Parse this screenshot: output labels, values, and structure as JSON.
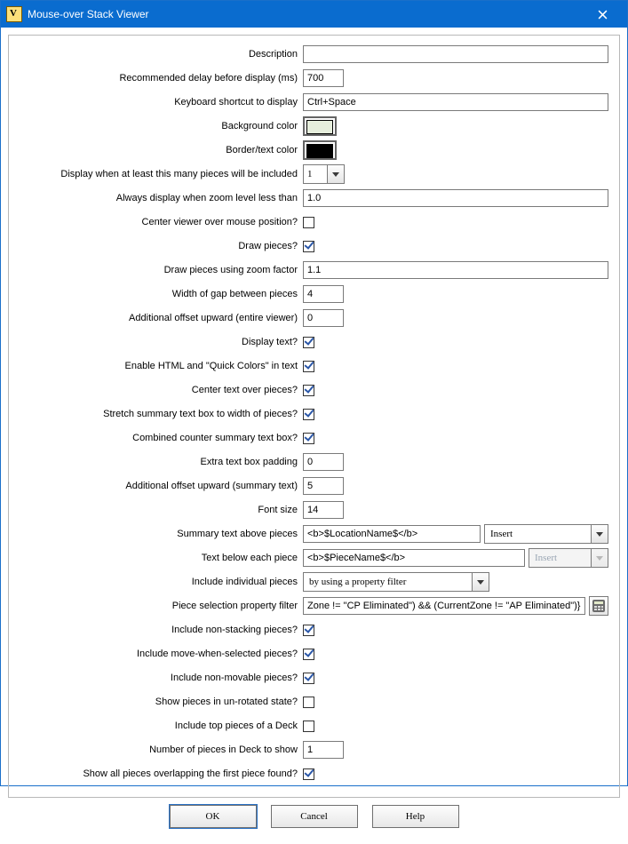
{
  "window": {
    "title": "Mouse-over Stack Viewer"
  },
  "colors": {
    "background_color_swatch": "#e6eedc",
    "border_text_color_swatch": "#000000"
  },
  "labels": {
    "description": "Description",
    "rec_delay": "Recommended delay before display (ms)",
    "kb_shortcut": "Keyboard shortcut to display",
    "bg_color": "Background color",
    "border_text_color": "Border/text color",
    "display_when_pieces": "Display when at least this many pieces will be included",
    "always_display_zoom": "Always display when zoom level less than",
    "center_viewer": "Center viewer over mouse position?",
    "draw_pieces": "Draw pieces?",
    "draw_zoom_factor": "Draw pieces using zoom factor",
    "gap_width": "Width of gap between pieces",
    "offset_upward_viewer": "Additional offset upward (entire viewer)",
    "display_text": "Display text?",
    "enable_html_colors": "Enable HTML and \"Quick Colors\" in text",
    "center_text": "Center text over pieces?",
    "stretch_textbox": "Stretch summary text box to width of pieces?",
    "combined_counter": "Combined counter summary text box?",
    "extra_padding": "Extra text box padding",
    "offset_upward_summary": "Additional offset upward (summary text)",
    "font_size": "Font size",
    "summary_above": "Summary text above pieces",
    "text_below": "Text below each piece",
    "include_individual": "Include individual pieces",
    "piece_filter": "Piece selection property filter",
    "include_nonstacking": "Include non-stacking pieces?",
    "include_movewhen": "Include move-when-selected pieces?",
    "include_nonmovable": "Include non-movable pieces?",
    "show_unrotated": "Show pieces in un-rotated state?",
    "include_top_deck": "Include top pieces of a Deck",
    "num_deck": "Number of pieces in Deck to show",
    "show_all_overlap": "Show all pieces overlapping the first piece found?"
  },
  "values": {
    "description": "",
    "rec_delay": "700",
    "kb_shortcut": "Ctrl+Space",
    "display_when_pieces": "1",
    "always_display_zoom": "1.0",
    "center_viewer": false,
    "draw_pieces": true,
    "draw_zoom_factor": "1.1",
    "gap_width": "4",
    "offset_upward_viewer": "0",
    "display_text": true,
    "enable_html_colors": true,
    "center_text": true,
    "stretch_textbox": true,
    "combined_counter": true,
    "extra_padding": "0",
    "offset_upward_summary": "5",
    "font_size": "14",
    "summary_above": "<b>$LocationName$</b>",
    "summary_above_insert": "Insert",
    "text_below": "<b>$PieceName$</b>",
    "text_below_insert": "Insert",
    "include_individual": "by using a property filter",
    "piece_filter": "Zone != \"CP Eliminated\") && (CurrentZone != \"AP Eliminated\")}",
    "include_nonstacking": true,
    "include_movewhen": true,
    "include_nonmovable": true,
    "show_unrotated": false,
    "include_top_deck": false,
    "num_deck": "1",
    "show_all_overlap": true
  },
  "buttons": {
    "ok": "OK",
    "cancel": "Cancel",
    "help": "Help"
  }
}
